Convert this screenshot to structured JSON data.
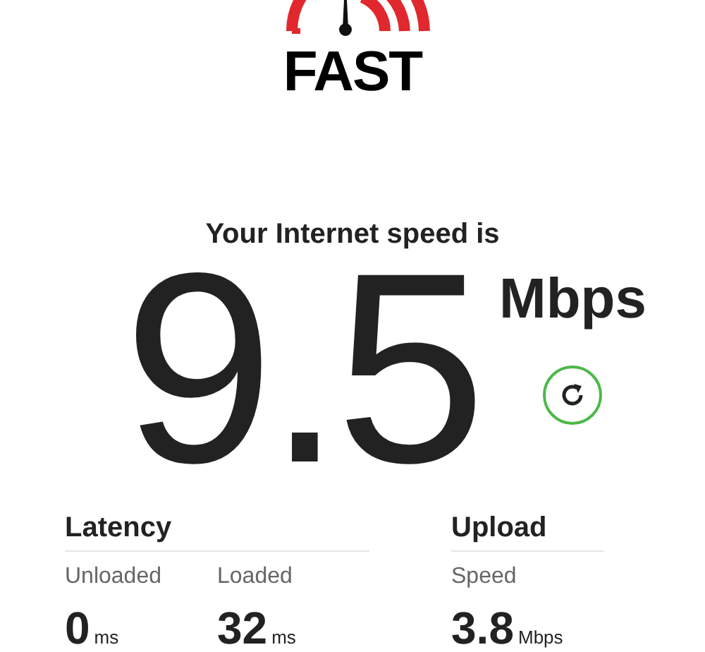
{
  "logo": {
    "text": "FAST"
  },
  "headline": "Your Internet speed is",
  "speed": {
    "value": "9.5",
    "unit": "Mbps"
  },
  "latency": {
    "title": "Latency",
    "items": [
      {
        "label": "Unloaded",
        "value": "0",
        "unit": "ms"
      },
      {
        "label": "Loaded",
        "value": "32",
        "unit": "ms"
      }
    ]
  },
  "upload": {
    "title": "Upload",
    "items": [
      {
        "label": "Speed",
        "value": "3.8",
        "unit": "Mbps"
      }
    ]
  }
}
